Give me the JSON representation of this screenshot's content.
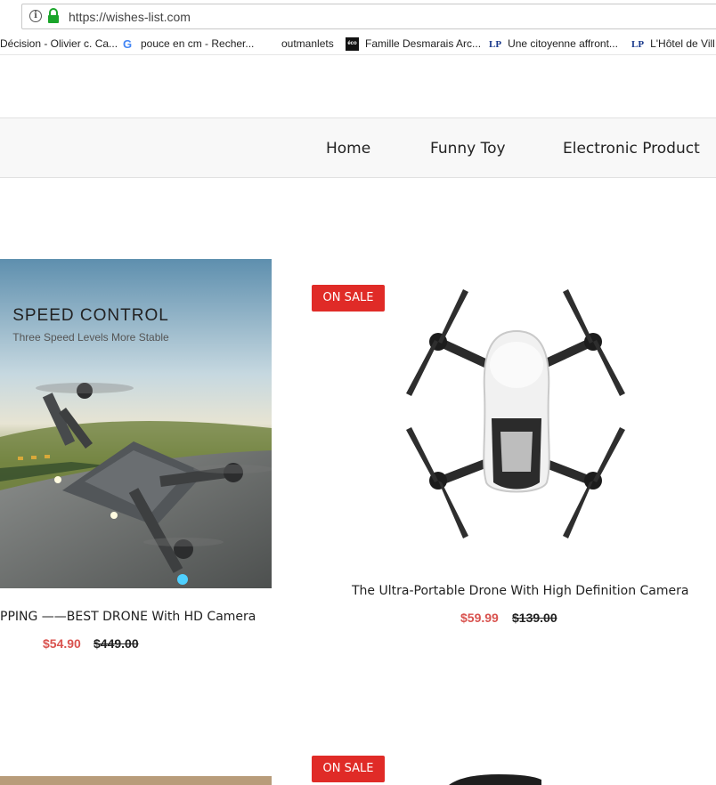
{
  "browser": {
    "url": "https://wishes-list.com"
  },
  "bookmarks": [
    {
      "label": "Décision - Olivier c. Ca...",
      "icon": "none"
    },
    {
      "label": "pouce en cm - Recher...",
      "icon": "google-icon"
    },
    {
      "label": "outmanlets",
      "icon": "none"
    },
    {
      "label": "Famille Desmarais Arc...",
      "icon": "eco-icon"
    },
    {
      "label": "Une citoyenne affront...",
      "icon": "lp-icon"
    },
    {
      "label": "L'Hôtel de Vill",
      "icon": "lp-icon"
    }
  ],
  "nav": {
    "items": [
      "Home",
      "Funny Toy",
      "Electronic Product"
    ]
  },
  "products": [
    {
      "name": "PPING ——BEST DRONE With HD Camera",
      "price": "$54.90",
      "old_price": "$449.00",
      "image_caption_title": "SPEED CONTROL",
      "image_caption_sub": "Three Speed Levels  More Stable"
    },
    {
      "badge": "ON SALE",
      "name": "The Ultra-Portable Drone With High Definition Camera",
      "price": "$59.99",
      "old_price": "$139.00"
    },
    {
      "badge": "ON SALE"
    }
  ],
  "colors": {
    "sale_badge": "#e02b27",
    "sale_price": "#d9534f",
    "nav_bg": "#f8f8f8"
  }
}
